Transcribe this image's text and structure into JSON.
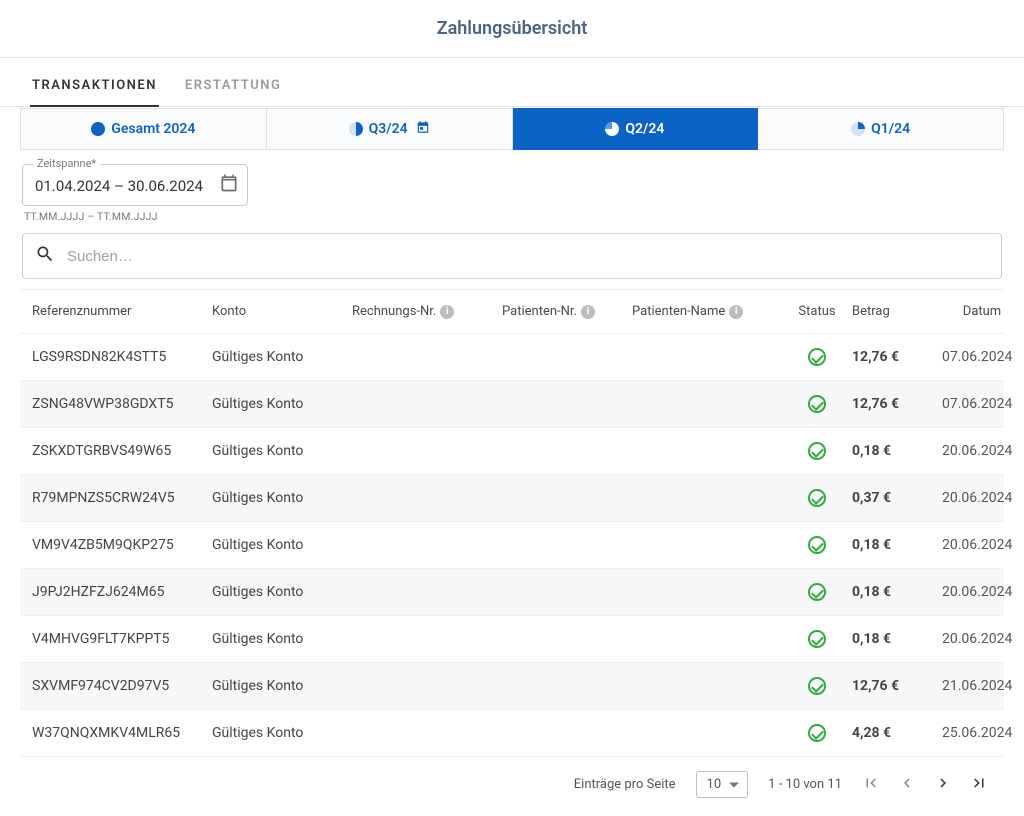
{
  "header": {
    "title": "Zahlungsübersicht"
  },
  "primary_tabs": {
    "items": [
      {
        "label": "TRANSAKTIONEN",
        "active": true
      },
      {
        "label": "ERSTATTUNG",
        "active": false
      }
    ]
  },
  "quarter_tabs": {
    "items": [
      {
        "label": "Gesamt 2024",
        "icon": "full-pie",
        "active": false
      },
      {
        "label": "Q3/24",
        "icon": "half-pie",
        "has_event_icon": true,
        "active": false
      },
      {
        "label": "Q2/24",
        "icon": "three-quarter-pie",
        "active": true
      },
      {
        "label": "Q1/24",
        "icon": "quarter-pie",
        "active": false
      }
    ]
  },
  "date_range": {
    "legend": "Zeitspanne*",
    "value": "01.04.2024  – 30.06.2024",
    "hint": "TT.MM.JJJJ – TT.MM.JJJJ"
  },
  "search": {
    "placeholder": "Suchen…"
  },
  "table": {
    "headers": {
      "ref": "Referenznummer",
      "account": "Konto",
      "invoice": "Rechnungs-Nr.",
      "patient_no": "Patienten-Nr.",
      "patient_name": "Patienten-Name",
      "status": "Status",
      "amount": "Betrag",
      "date": "Datum"
    },
    "rows": [
      {
        "ref": "LGS9RSDN82K4STT5",
        "account": "Gültiges Konto",
        "amount": "12,76 €",
        "date": "07.06.2024"
      },
      {
        "ref": "ZSNG48VWP38GDXT5",
        "account": "Gültiges Konto",
        "amount": "12,76 €",
        "date": "07.06.2024"
      },
      {
        "ref": "ZSKXDTGRBVS49W65",
        "account": "Gültiges Konto",
        "amount": "0,18 €",
        "date": "20.06.2024"
      },
      {
        "ref": "R79MPNZS5CRW24V5",
        "account": "Gültiges Konto",
        "amount": "0,37 €",
        "date": "20.06.2024"
      },
      {
        "ref": "VM9V4ZB5M9QKP275",
        "account": "Gültiges Konto",
        "amount": "0,18 €",
        "date": "20.06.2024"
      },
      {
        "ref": "J9PJ2HZFZJ624M65",
        "account": "Gültiges Konto",
        "amount": "0,18 €",
        "date": "20.06.2024"
      },
      {
        "ref": "V4MHVG9FLT7KPPT5",
        "account": "Gültiges Konto",
        "amount": "0,18 €",
        "date": "20.06.2024"
      },
      {
        "ref": "SXVMF974CV2D97V5",
        "account": "Gültiges Konto",
        "amount": "12,76 €",
        "date": "21.06.2024"
      },
      {
        "ref": "W37QNQXMKV4MLR65",
        "account": "Gültiges Konto",
        "amount": "4,28 €",
        "date": "25.06.2024"
      }
    ]
  },
  "pager": {
    "items_label": "Einträge pro Seite",
    "page_size": "10",
    "range": "1 - 10 von 11"
  }
}
